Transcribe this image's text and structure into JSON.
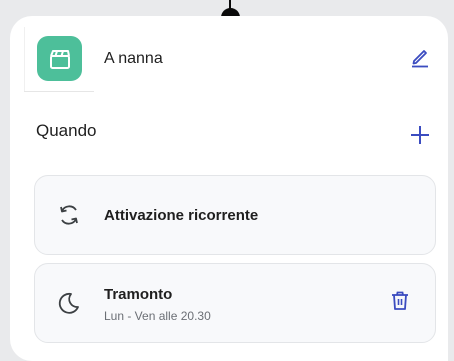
{
  "header": {
    "title": "A nanna",
    "app_icon": "clapperboard-icon",
    "edit_icon": "pencil-icon",
    "accent_color": "#4dbf9a",
    "action_color": "#3b4cc0"
  },
  "when_section": {
    "label": "Quando",
    "add_icon": "plus-icon"
  },
  "triggers": [
    {
      "icon": "recurring-arrows-icon",
      "title": "Attivazione ricorrente",
      "subtitle": ""
    },
    {
      "icon": "moon-icon",
      "title": "Tramonto",
      "subtitle": "Lun - Ven alle 20.30",
      "action_icon": "trash-icon"
    }
  ]
}
